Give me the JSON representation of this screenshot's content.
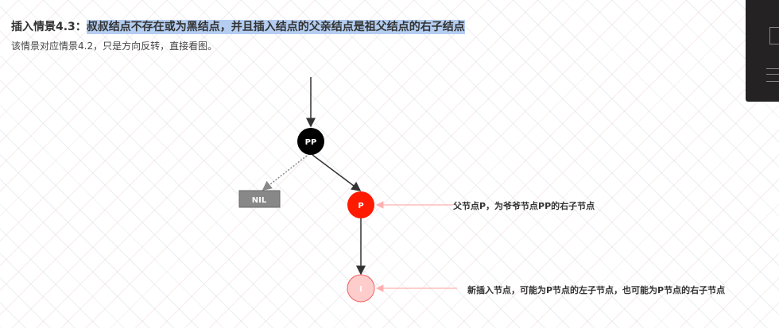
{
  "heading": {
    "prefix": "插入情景4.3：",
    "highlight": "叔叔结点不存在或为黑结点，并且插入结点的父亲结点是祖父结点的右子结点"
  },
  "subtitle": "该情景对应情景4.2，只是方向反转，直接看图。",
  "nodes": {
    "pp": "PP",
    "nil": "NIL",
    "p": "P",
    "i": "I"
  },
  "annotations": {
    "p": "父节点P，为爷爷节点PP的右子节点",
    "i": "新插入节点，可能为P节点的左子节点，也可能为P节点的右子节点"
  },
  "colors": {
    "black": "#000000",
    "red": "#ff1a00",
    "pink": "#ffcccc",
    "nil": "#888888"
  }
}
